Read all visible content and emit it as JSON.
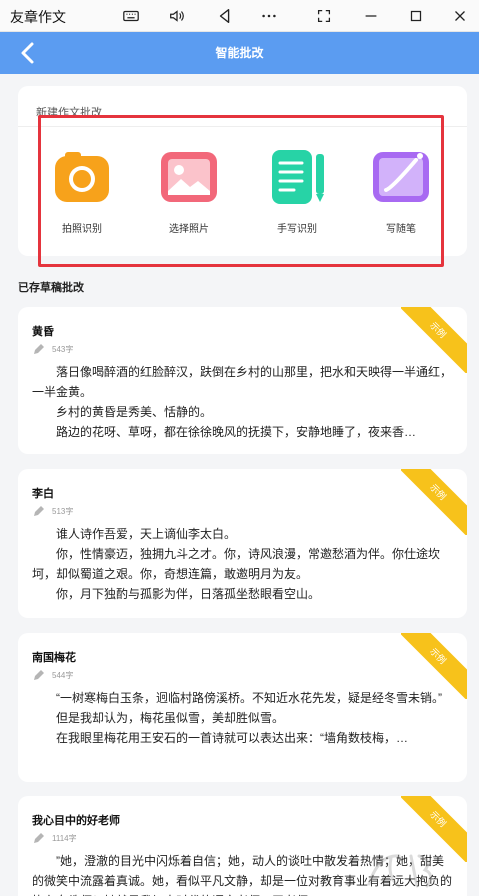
{
  "window": {
    "title": "友章作文",
    "icons": [
      "keyboard-icon",
      "volume-icon",
      "back-triangle-icon",
      "more-icon",
      "screenshot-icon",
      "minimize-icon",
      "maximize-icon",
      "close-icon"
    ]
  },
  "header": {
    "title": "智能批改"
  },
  "new_section": {
    "label": "新建作文批改",
    "tools": [
      {
        "label": "拍照识别",
        "icon": "camera-icon",
        "color": "#f7a21b"
      },
      {
        "label": "选择照片",
        "icon": "photo-icon",
        "color": "#f2687a"
      },
      {
        "label": "手写识别",
        "icon": "handwriting-icon",
        "color": "#27d3a6"
      },
      {
        "label": "写随笔",
        "icon": "pen-note-icon",
        "color": "#a86af2"
      }
    ]
  },
  "drafts": {
    "title": "已存草稿批改",
    "items": [
      {
        "title": "黄昏",
        "count": "543字",
        "badge": "示例",
        "lines": [
          "落日像喝醉酒的红脸醉汉，趺倒在乡村的山那里，把水和天映得一半通红，一半金黄。",
          "乡村的黄昏是秀美、恬静的。",
          "路边的花呀、草呀，都在徐徐晚风的抚摸下，安静地睡了，夜来香…"
        ]
      },
      {
        "title": "李白",
        "count": "513字",
        "badge": "示例",
        "lines": [
          "谁人诗作吾爱，天上谪仙李太白。",
          "你，性情豪迈，独拥九斗之才。你，诗风浪漫，常邀愁酒为伴。你仕途坎坷，却似蜀道之艰。你，奇想连篇，敢邀明月为友。",
          "你，月下独酌与孤影为伴，日落孤坐愁眼看空山。"
        ]
      },
      {
        "title": "南国梅花",
        "count": "544字",
        "badge": "示例",
        "lines": [
          "“一树寒梅白玉条，迥临村路傍溪桥。不知近水花先发，疑是经冬雪未销。”",
          "但是我却认为，梅花虽似雪，美却胜似雪。",
          "在我眼里梅花用王安石的一首诗就可以表达出来：“墙角数枝梅，…"
        ]
      },
      {
        "title": "我心目中的好老师",
        "count": "1114字",
        "badge": "示例",
        "lines": [
          "”她，澄澈的目光中闪烁着自信；她，动人的谈吐中散发着热情；她，甜美的微笑中流露着真诚。她，看似平凡文静，却是一位对教育事业有着远大抱负的执在女教师！她就是我初中时代的语文老师，王老师。"
        ]
      }
    ]
  }
}
